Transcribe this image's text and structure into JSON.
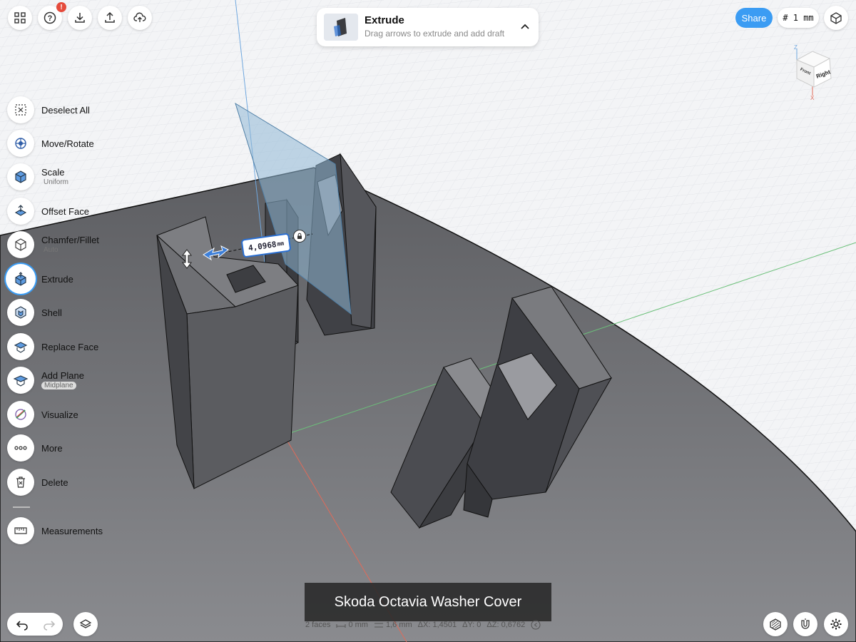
{
  "top_left": {
    "buttons": [
      {
        "name": "apps-grid-button",
        "icon": "grid-icon"
      },
      {
        "name": "help-button",
        "icon": "question-icon",
        "badge": "!"
      },
      {
        "name": "import-button",
        "icon": "download-icon"
      },
      {
        "name": "export-button",
        "icon": "upload-icon"
      },
      {
        "name": "cloud-upload-button",
        "icon": "cloud-upload-icon"
      }
    ]
  },
  "tool_banner": {
    "title": "Extrude",
    "hint": "Drag arrows to extrude and add draft"
  },
  "top_right": {
    "share_label": "Share",
    "grid_size": "# 1 mm"
  },
  "view_cube": {
    "faces": {
      "front": "Front",
      "right": "Right"
    },
    "axes": {
      "z": "Z",
      "x": "X"
    }
  },
  "toolbar": {
    "items": [
      {
        "label": "Deselect All",
        "sub": "",
        "icon": "deselect-icon"
      },
      {
        "label": "Move/Rotate",
        "sub": "",
        "icon": "move-rotate-icon"
      },
      {
        "label": "Scale",
        "sub": "Uniform",
        "icon": "scale-icon"
      },
      {
        "label": "Offset Face",
        "sub": "",
        "icon": "offset-face-icon"
      },
      {
        "label": "Chamfer/Fillet",
        "sub": "Auto",
        "icon": "chamfer-icon"
      },
      {
        "label": "Extrude",
        "sub": "",
        "icon": "extrude-icon",
        "active": true
      },
      {
        "label": "Shell",
        "sub": "",
        "icon": "shell-icon"
      },
      {
        "label": "Replace Face",
        "sub": "",
        "icon": "replace-face-icon"
      },
      {
        "label": "Add Plane",
        "sub": "Midplane",
        "icon": "add-plane-icon"
      },
      {
        "label": "Visualize",
        "sub": "",
        "icon": "visualize-icon"
      },
      {
        "label": "More",
        "sub": "",
        "icon": "more-icon"
      },
      {
        "label": "Delete",
        "sub": "",
        "icon": "delete-icon"
      },
      {
        "label": "Measurements",
        "sub": "",
        "icon": "measurements-icon"
      }
    ]
  },
  "dimension": {
    "value": "4,0968",
    "unit": "mm"
  },
  "caption": "Skoda Octavia Washer Cover",
  "status": {
    "faces": "2 faces",
    "distance": "0 mm",
    "thickness": "1,6 mm",
    "dx": "ΔX: 1,4501",
    "dy": "ΔY: 0",
    "dz": "ΔZ: 0,6762"
  },
  "colors": {
    "accent": "#3b9cf3",
    "floor": "#6d6e72",
    "solid": "#4a4b50",
    "plane": "#8fb8d6"
  }
}
